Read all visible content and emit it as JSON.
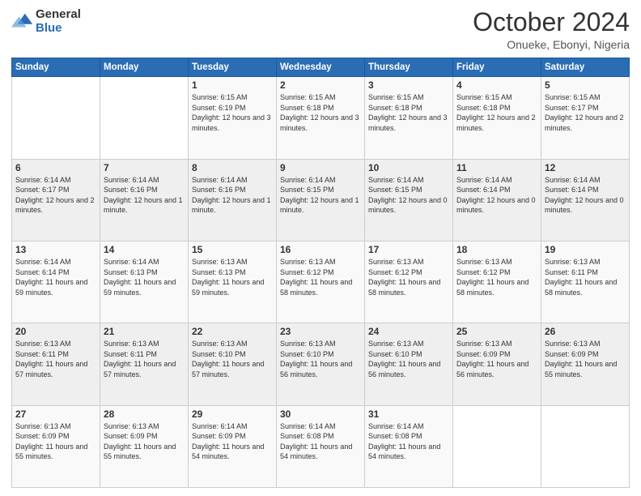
{
  "header": {
    "logo_general": "General",
    "logo_blue": "Blue",
    "title": "October 2024",
    "subtitle": "Onueke, Ebonyi, Nigeria"
  },
  "days_of_week": [
    "Sunday",
    "Monday",
    "Tuesday",
    "Wednesday",
    "Thursday",
    "Friday",
    "Saturday"
  ],
  "weeks": [
    [
      {
        "day": "",
        "info": ""
      },
      {
        "day": "",
        "info": ""
      },
      {
        "day": "1",
        "info": "Sunrise: 6:15 AM\nSunset: 6:19 PM\nDaylight: 12 hours and 3 minutes."
      },
      {
        "day": "2",
        "info": "Sunrise: 6:15 AM\nSunset: 6:18 PM\nDaylight: 12 hours and 3 minutes."
      },
      {
        "day": "3",
        "info": "Sunrise: 6:15 AM\nSunset: 6:18 PM\nDaylight: 12 hours and 3 minutes."
      },
      {
        "day": "4",
        "info": "Sunrise: 6:15 AM\nSunset: 6:18 PM\nDaylight: 12 hours and 2 minutes."
      },
      {
        "day": "5",
        "info": "Sunrise: 6:15 AM\nSunset: 6:17 PM\nDaylight: 12 hours and 2 minutes."
      }
    ],
    [
      {
        "day": "6",
        "info": "Sunrise: 6:14 AM\nSunset: 6:17 PM\nDaylight: 12 hours and 2 minutes."
      },
      {
        "day": "7",
        "info": "Sunrise: 6:14 AM\nSunset: 6:16 PM\nDaylight: 12 hours and 1 minute."
      },
      {
        "day": "8",
        "info": "Sunrise: 6:14 AM\nSunset: 6:16 PM\nDaylight: 12 hours and 1 minute."
      },
      {
        "day": "9",
        "info": "Sunrise: 6:14 AM\nSunset: 6:15 PM\nDaylight: 12 hours and 1 minute."
      },
      {
        "day": "10",
        "info": "Sunrise: 6:14 AM\nSunset: 6:15 PM\nDaylight: 12 hours and 0 minutes."
      },
      {
        "day": "11",
        "info": "Sunrise: 6:14 AM\nSunset: 6:14 PM\nDaylight: 12 hours and 0 minutes."
      },
      {
        "day": "12",
        "info": "Sunrise: 6:14 AM\nSunset: 6:14 PM\nDaylight: 12 hours and 0 minutes."
      }
    ],
    [
      {
        "day": "13",
        "info": "Sunrise: 6:14 AM\nSunset: 6:14 PM\nDaylight: 11 hours and 59 minutes."
      },
      {
        "day": "14",
        "info": "Sunrise: 6:14 AM\nSunset: 6:13 PM\nDaylight: 11 hours and 59 minutes."
      },
      {
        "day": "15",
        "info": "Sunrise: 6:13 AM\nSunset: 6:13 PM\nDaylight: 11 hours and 59 minutes."
      },
      {
        "day": "16",
        "info": "Sunrise: 6:13 AM\nSunset: 6:12 PM\nDaylight: 11 hours and 58 minutes."
      },
      {
        "day": "17",
        "info": "Sunrise: 6:13 AM\nSunset: 6:12 PM\nDaylight: 11 hours and 58 minutes."
      },
      {
        "day": "18",
        "info": "Sunrise: 6:13 AM\nSunset: 6:12 PM\nDaylight: 11 hours and 58 minutes."
      },
      {
        "day": "19",
        "info": "Sunrise: 6:13 AM\nSunset: 6:11 PM\nDaylight: 11 hours and 58 minutes."
      }
    ],
    [
      {
        "day": "20",
        "info": "Sunrise: 6:13 AM\nSunset: 6:11 PM\nDaylight: 11 hours and 57 minutes."
      },
      {
        "day": "21",
        "info": "Sunrise: 6:13 AM\nSunset: 6:11 PM\nDaylight: 11 hours and 57 minutes."
      },
      {
        "day": "22",
        "info": "Sunrise: 6:13 AM\nSunset: 6:10 PM\nDaylight: 11 hours and 57 minutes."
      },
      {
        "day": "23",
        "info": "Sunrise: 6:13 AM\nSunset: 6:10 PM\nDaylight: 11 hours and 56 minutes."
      },
      {
        "day": "24",
        "info": "Sunrise: 6:13 AM\nSunset: 6:10 PM\nDaylight: 11 hours and 56 minutes."
      },
      {
        "day": "25",
        "info": "Sunrise: 6:13 AM\nSunset: 6:09 PM\nDaylight: 11 hours and 56 minutes."
      },
      {
        "day": "26",
        "info": "Sunrise: 6:13 AM\nSunset: 6:09 PM\nDaylight: 11 hours and 55 minutes."
      }
    ],
    [
      {
        "day": "27",
        "info": "Sunrise: 6:13 AM\nSunset: 6:09 PM\nDaylight: 11 hours and 55 minutes."
      },
      {
        "day": "28",
        "info": "Sunrise: 6:13 AM\nSunset: 6:09 PM\nDaylight: 11 hours and 55 minutes."
      },
      {
        "day": "29",
        "info": "Sunrise: 6:14 AM\nSunset: 6:09 PM\nDaylight: 11 hours and 54 minutes."
      },
      {
        "day": "30",
        "info": "Sunrise: 6:14 AM\nSunset: 6:08 PM\nDaylight: 11 hours and 54 minutes."
      },
      {
        "day": "31",
        "info": "Sunrise: 6:14 AM\nSunset: 6:08 PM\nDaylight: 11 hours and 54 minutes."
      },
      {
        "day": "",
        "info": ""
      },
      {
        "day": "",
        "info": ""
      }
    ]
  ]
}
